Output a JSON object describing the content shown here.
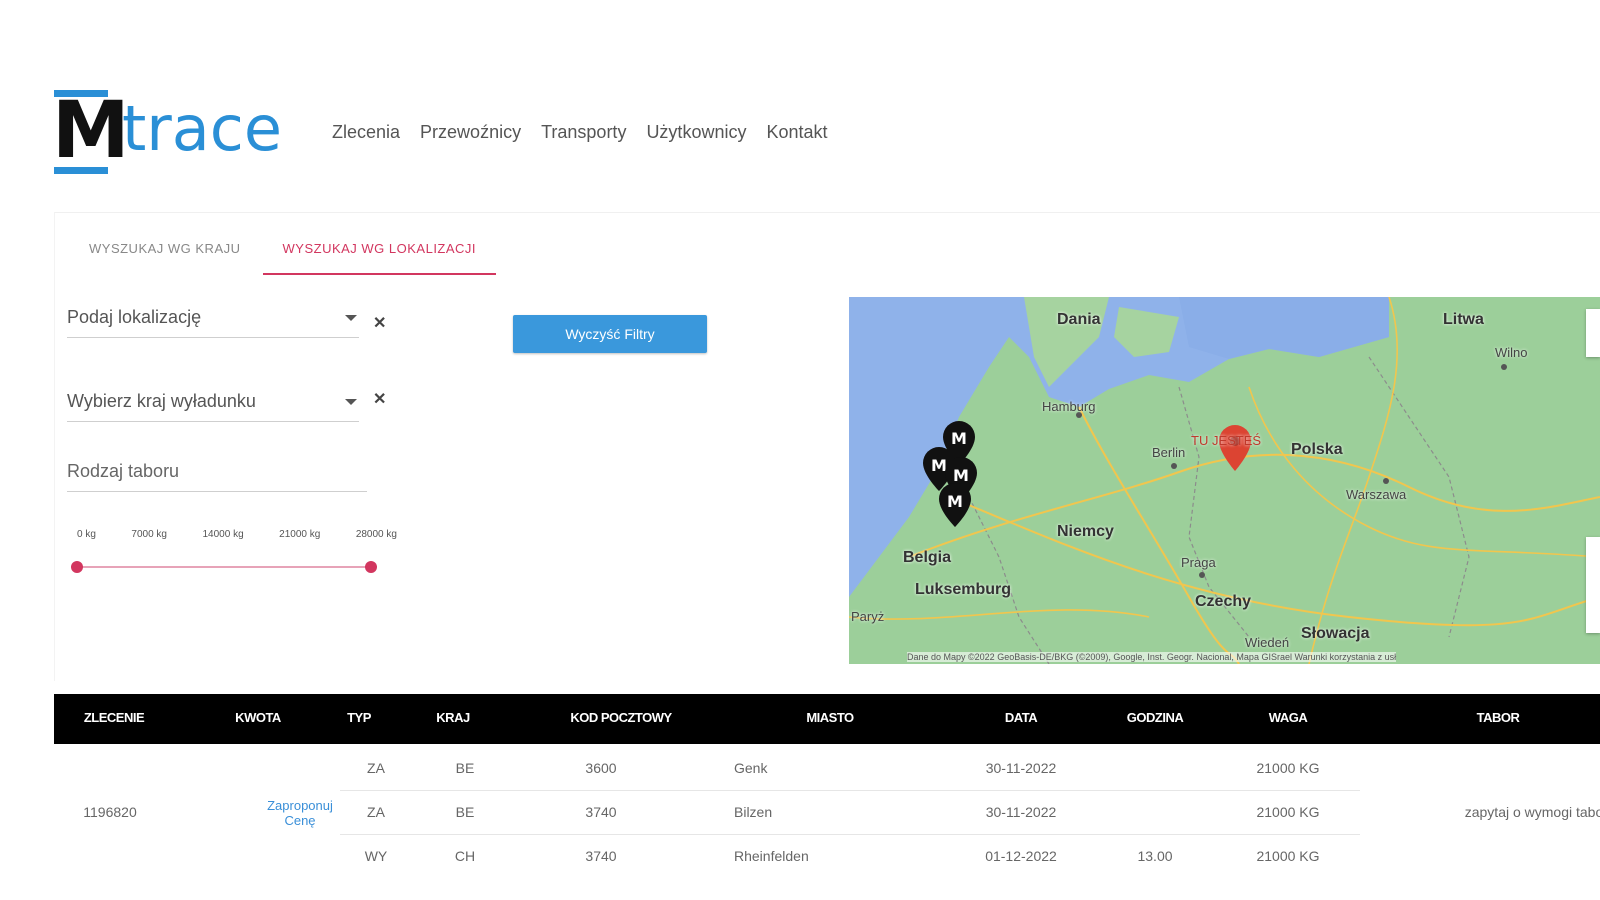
{
  "logo": {
    "letter": "M",
    "word": "trace",
    "accent": "#2a8fd6"
  },
  "nav": [
    "Zlecenia",
    "Przewoźnicy",
    "Transporty",
    "Użytkownicy",
    "Kontakt"
  ],
  "tabs": [
    {
      "label": "Wyszukaj wg kraju",
      "active": false
    },
    {
      "label": "Wyszukaj wg lokalizacji",
      "active": true
    }
  ],
  "filters": {
    "location_placeholder": "Podaj lokalizację",
    "country_placeholder": "Wybierz kraj wyładunku",
    "fleet_placeholder": "Rodzaj taboru",
    "clear_icon": "close-icon",
    "clear_button": "Wyczyść Filtry"
  },
  "weight_slider": {
    "ticks": [
      "0 kg",
      "7000 kg",
      "14000 kg",
      "21000 kg",
      "28000 kg"
    ],
    "min": 0,
    "max": 28000,
    "value_low": 0,
    "value_high": 28000,
    "color": "#d2365f"
  },
  "map": {
    "labels": [
      "Dania",
      "Litwa",
      "Hamburg",
      "Berlin",
      "TU JESTEŚ",
      "Polska",
      "Warszawa",
      "Niemcy",
      "Belgia",
      "Luksemburg",
      "Praga",
      "Czechy",
      "Słowacja",
      "Wiedeń",
      "Paryż",
      "Wilno"
    ],
    "attribution": "Dane do Mapy ©2022 GeoBasis-DE/BKG (©2009), Google, Inst. Geogr. Nacional, Mapa GISrael    Warunki korzystania z usł"
  },
  "table": {
    "headers": [
      "Zlecenie",
      "Kwota",
      "Typ",
      "Kraj",
      "Kod pocztowy",
      "Miasto",
      "Data",
      "Godzina",
      "Waga",
      "Tabor"
    ],
    "order_id": "1196820",
    "price_action": "Zaproponuj Cenę",
    "fleet_note": "zapytaj o wymogi tabo",
    "rows": [
      {
        "typ": "ZA",
        "kraj": "BE",
        "kod": "3600",
        "miasto": "Genk",
        "data": "30-11-2022",
        "godzina": "",
        "waga": "21000 KG"
      },
      {
        "typ": "ZA",
        "kraj": "BE",
        "kod": "3740",
        "miasto": "Bilzen",
        "data": "30-11-2022",
        "godzina": "",
        "waga": "21000 KG"
      },
      {
        "typ": "WY",
        "kraj": "CH",
        "kod": "3740",
        "miasto": "Rheinfelden",
        "data": "01-12-2022",
        "godzina": "13.00",
        "waga": "21000 KG"
      }
    ]
  }
}
